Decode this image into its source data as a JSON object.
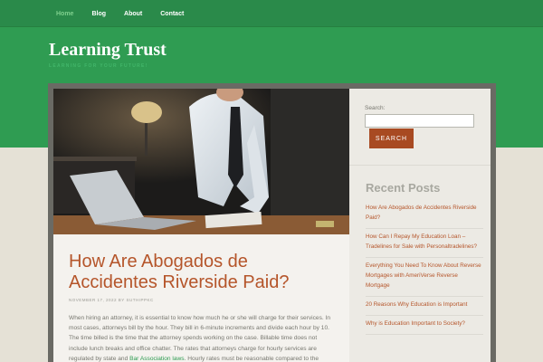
{
  "nav": {
    "items": [
      {
        "label": "Home",
        "active": true
      },
      {
        "label": "Blog",
        "active": false
      },
      {
        "label": "About",
        "active": false
      },
      {
        "label": "Contact",
        "active": false
      }
    ]
  },
  "site": {
    "title": "Learning Trust",
    "tagline": "LEARNING FOR YOUR FUTURE!"
  },
  "post": {
    "title": "How Are Abogados de Accidentes Riverside Paid?",
    "meta": "NOVEMBER 17, 2022 BY SUTHIPPKC",
    "body_text": "When hiring an attorney, it is essential to know how much he or she will charge for their services. In most cases, attorneys bill by the hour. They bill in 6-minute increments and divide each hour by 10. The time billed is the time that the attorney spends working on the case. Billable time does not include lunch breaks and office chatter. The rates that attorneys charge for hourly services are regulated by state and",
    "body_link": "Bar Association laws",
    "body_tail": ". Hourly rates must be reasonable compared to the"
  },
  "sidebar": {
    "search_label": "Search:",
    "search_value": "",
    "search_button": "SEARCH",
    "recent_title": "Recent Posts",
    "recent_posts": [
      "How Are Abogados de Accidentes Riverside Paid?",
      "How Can I Repay My Education Loan – Tradelines for Sale with Personaltradelines?",
      "Everything You Need To Know About Reverse Mortgages with AmeriVerse Reverse Mortgage",
      "20 Reasons Why Education is Important",
      "Why is Education Important to Society?"
    ]
  },
  "colors": {
    "nav_bg": "#2a8a4a",
    "hero_bg": "#2f9c52",
    "accent": "#b5552a",
    "button": "#a84a22",
    "page_bg": "#e5e1d6"
  },
  "image": {
    "description_icon": "photo-man-laptop"
  }
}
